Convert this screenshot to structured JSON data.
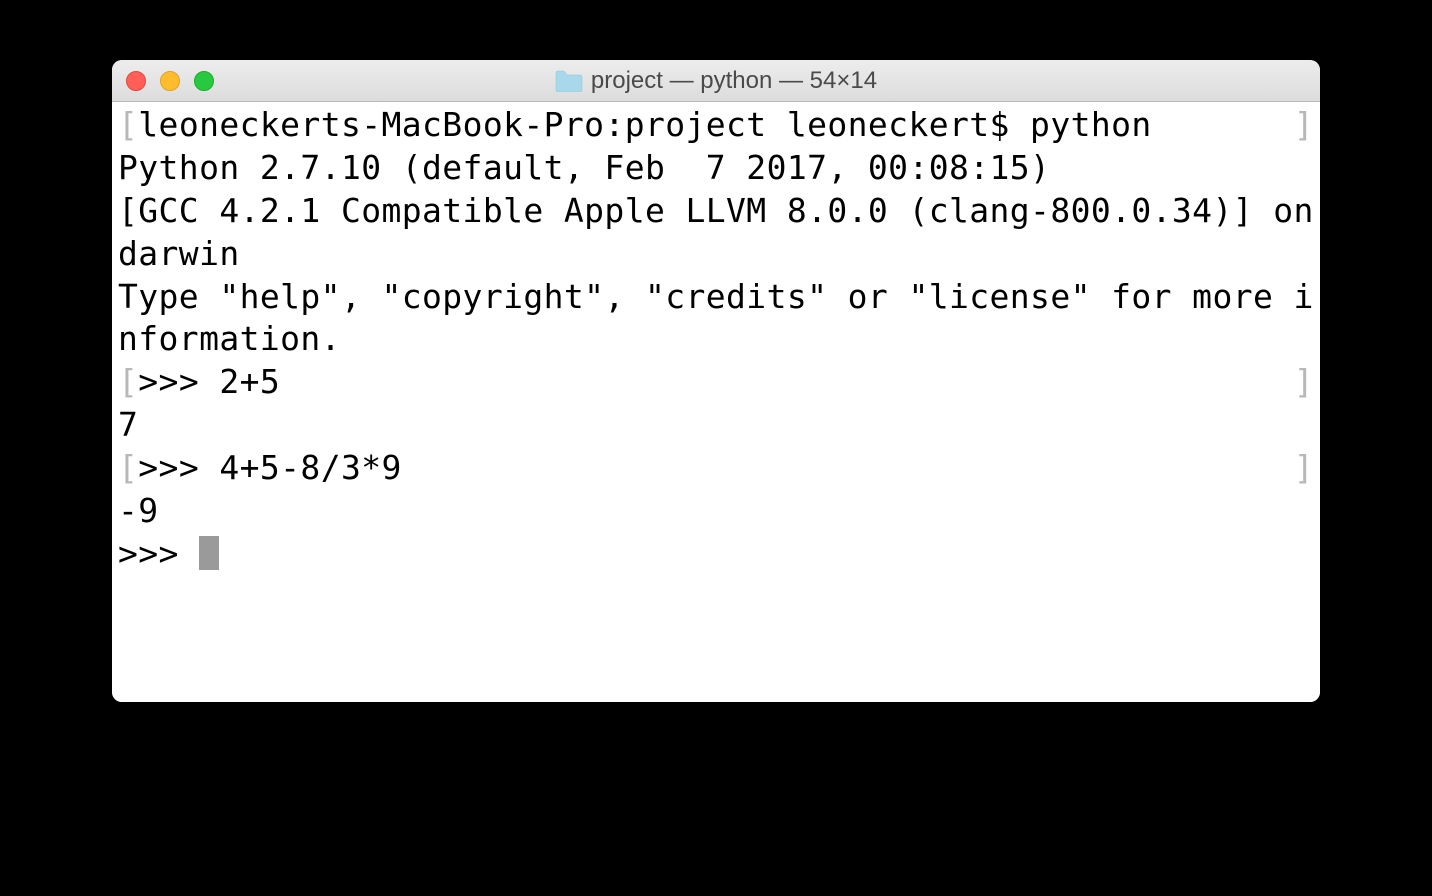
{
  "window": {
    "title": "project — python — 54×14"
  },
  "terminal": {
    "lines": [
      {
        "bracket_left": "[",
        "text": "leoneckerts-MacBook-Pro:project leoneckert$ python",
        "bracket_right": "]"
      },
      {
        "text": "Python 2.7.10 (default, Feb  7 2017, 00:08:15)"
      },
      {
        "text": "[GCC 4.2.1 Compatible Apple LLVM 8.0.0 (clang-800.0.34)] on darwin"
      },
      {
        "text": "Type \"help\", \"copyright\", \"credits\" or \"license\" for more information."
      },
      {
        "bracket_left": "[",
        "text": ">>> 2+5",
        "bracket_right": "]"
      },
      {
        "text": "7"
      },
      {
        "bracket_left": "[",
        "text": ">>> 4+5-8/3*9",
        "bracket_right": "]"
      },
      {
        "text": "-9"
      },
      {
        "text": ">>> ",
        "cursor": true
      }
    ]
  }
}
